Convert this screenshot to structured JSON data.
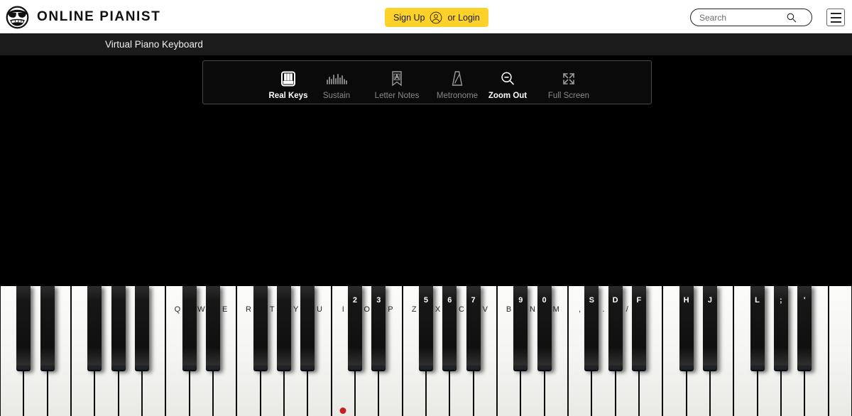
{
  "header": {
    "brand_name": "ONLINE PIANIST",
    "logo_icon": "sunglasses-face-logo",
    "auth": {
      "signup_label": "Sign Up",
      "login_label": "or Login",
      "avatar_icon": "person-circle-icon",
      "background": "#fcd12a"
    },
    "search": {
      "placeholder": "Search",
      "value": "",
      "icon": "search-icon"
    },
    "menu_icon": "hamburger-menu-icon"
  },
  "breadcrumb": {
    "title": "Virtual Piano Keyboard"
  },
  "toolbar": {
    "items": [
      {
        "id": "real-keys",
        "label": "Real Keys",
        "icon": "piano-keys-icon",
        "active": true
      },
      {
        "id": "sustain",
        "label": "Sustain",
        "icon": "waveform-icon",
        "active": false
      },
      {
        "id": "letter-notes",
        "label": "Letter Notes",
        "icon": "letter-page-icon",
        "active": false
      },
      {
        "id": "metronome",
        "label": "Metronome",
        "icon": "metronome-icon",
        "active": false
      },
      {
        "id": "zoom-out",
        "label": "Zoom Out",
        "icon": "zoom-out-icon",
        "active": true
      },
      {
        "id": "full-screen",
        "label": "Full Screen",
        "icon": "fullscreen-icon",
        "active": false
      }
    ],
    "active_color": "#ffffff",
    "idle_color": "#8a8a8a"
  },
  "piano": {
    "white_key_count": 36,
    "white_key_width": 33.33,
    "middle_c_index": 14,
    "middle_c_marker_color": "#c42020",
    "white_labels": [
      "",
      "",
      "",
      "",
      "",
      "",
      "",
      "Q",
      "W",
      "E",
      "R",
      "T",
      "Y",
      "U",
      "I",
      "O",
      "P",
      "Z",
      "X",
      "C",
      "V",
      "B",
      "N",
      "M",
      ",",
      ".",
      "/",
      "",
      "",
      "",
      "",
      "",
      "",
      "",
      "",
      ""
    ],
    "black_labels": [
      "",
      "",
      "",
      "",
      "",
      "",
      "",
      "",
      "",
      "",
      "2",
      "3",
      "5",
      "6",
      "7",
      "9",
      "0",
      "S",
      "D",
      "F",
      "H",
      "J",
      "L",
      ";",
      "'",
      "",
      "",
      "",
      "",
      "",
      ""
    ],
    "black_key_after_white": [
      0,
      1,
      3,
      4,
      5,
      7,
      8,
      10,
      11,
      12,
      14,
      15,
      17,
      18,
      19,
      21,
      22,
      24,
      25,
      26,
      28,
      29,
      31,
      32,
      33
    ]
  }
}
